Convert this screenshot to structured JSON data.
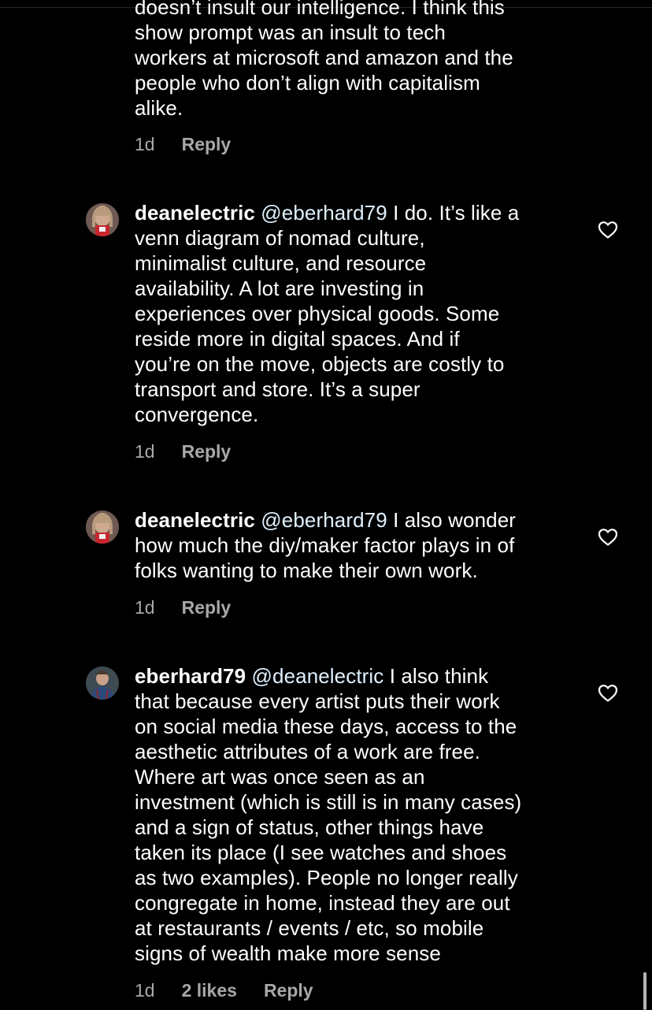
{
  "comments": [
    {
      "lines": [
        "doesn’t insult our intelligence. I think this",
        "show prompt was an insult to tech",
        "workers at microsoft and amazon and the",
        "people who don’t align with capitalism",
        "alike."
      ],
      "time": "1d",
      "reply": "Reply"
    },
    {
      "username": "deanelectric",
      "mention": "@eberhard79",
      "first_line_text": " I do. It’s like a",
      "lines": [
        "venn diagram of nomad culture,",
        "minimalist culture, and resource",
        "availability. A lot are investing in",
        "experiences over physical goods. Some",
        "reside more in digital spaces. And if",
        "you’re on the move, objects are costly to",
        "transport and store. It’s a super",
        "convergence."
      ],
      "time": "1d",
      "reply": "Reply"
    },
    {
      "username": "deanelectric",
      "mention": "@eberhard79",
      "first_line_text": " I also wonder",
      "lines": [
        "how much the diy/maker factor plays in of",
        "folks wanting to make their own work."
      ],
      "time": "1d",
      "reply": "Reply"
    },
    {
      "username": "eberhard79",
      "mention": "@deanelectric",
      "first_line_text": " I also think",
      "lines": [
        "that because every artist puts their work",
        "on social media these days, access to the",
        "aesthetic attributes of a work are free.",
        "Where art was once seen as an",
        "investment (which is still is in many cases)",
        "and a sign of status, other things have",
        "taken its place (I see watches and shoes",
        "as two examples). People no longer really",
        "congregate in home, instead they are out",
        "at restaurants / events / etc, so mobile",
        "signs of wealth make more sense"
      ],
      "time": "1d",
      "likes": "2 likes",
      "reply": "Reply"
    }
  ],
  "icons": {
    "like": "heart-outline-icon",
    "avatar": "profile-photo"
  },
  "colors": {
    "background": "#000000",
    "text": "#ffffff",
    "meta": "#a8a8a8",
    "mention": "#e0f1ff"
  }
}
